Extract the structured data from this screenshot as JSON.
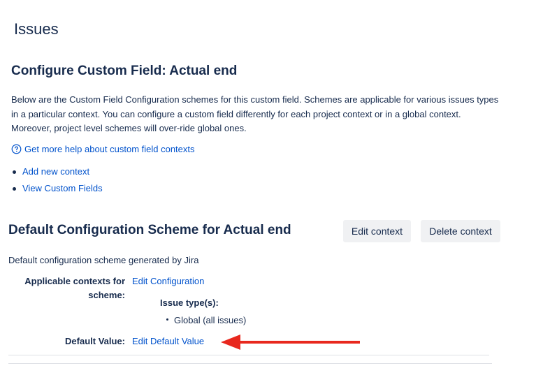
{
  "page": {
    "header": "Issues",
    "title": "Configure Custom Field: Actual end",
    "description": "Below are the Custom Field Configuration schemes for this custom field. Schemes are applicable for various issues types in a particular context. You can configure a custom field differently for each project context or in a global context. Moreover, project level schemes will over-ride global ones.",
    "help_link": "Get more help about custom field contexts",
    "actions": [
      "Add new context",
      "View Custom Fields"
    ]
  },
  "scheme": {
    "title": "Default Configuration Scheme for Actual end",
    "edit_button": "Edit context",
    "delete_button": "Delete context",
    "description": "Default configuration scheme generated by Jira",
    "contexts_label": "Applicable contexts for scheme:",
    "edit_configuration_link": "Edit Configuration",
    "issue_types_heading": "Issue type(s):",
    "issue_types": [
      "Global (all issues)"
    ],
    "default_value_label": "Default Value:",
    "edit_default_value_link": "Edit Default Value"
  },
  "colors": {
    "link": "#0052cc",
    "text": "#172b4d",
    "button_bg": "#f0f1f3",
    "arrow": "#e8281e"
  },
  "icons": {
    "help": "question-circle-icon",
    "annotation": "arrow-left-icon"
  }
}
